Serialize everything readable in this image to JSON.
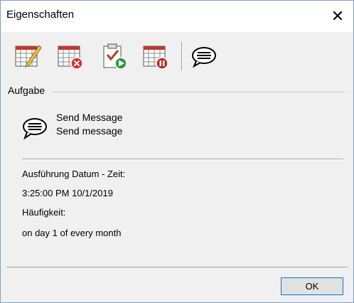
{
  "window": {
    "title": "Eigenschaften"
  },
  "toolbar": {
    "buttons": [
      "edit-schedule",
      "delete-schedule",
      "run-task",
      "pause-schedule",
      "send-message"
    ]
  },
  "task": {
    "group_label": "Aufgabe",
    "name": "Send Message",
    "description": "Send message"
  },
  "details": {
    "execution_label": "Ausführung Datum - Zeit:",
    "execution_value": "3:25:00 PM 10/1/2019",
    "frequency_label": "Häufigkeit:",
    "frequency_value": "on day 1 of every month"
  },
  "footer": {
    "ok_label": "OK"
  }
}
